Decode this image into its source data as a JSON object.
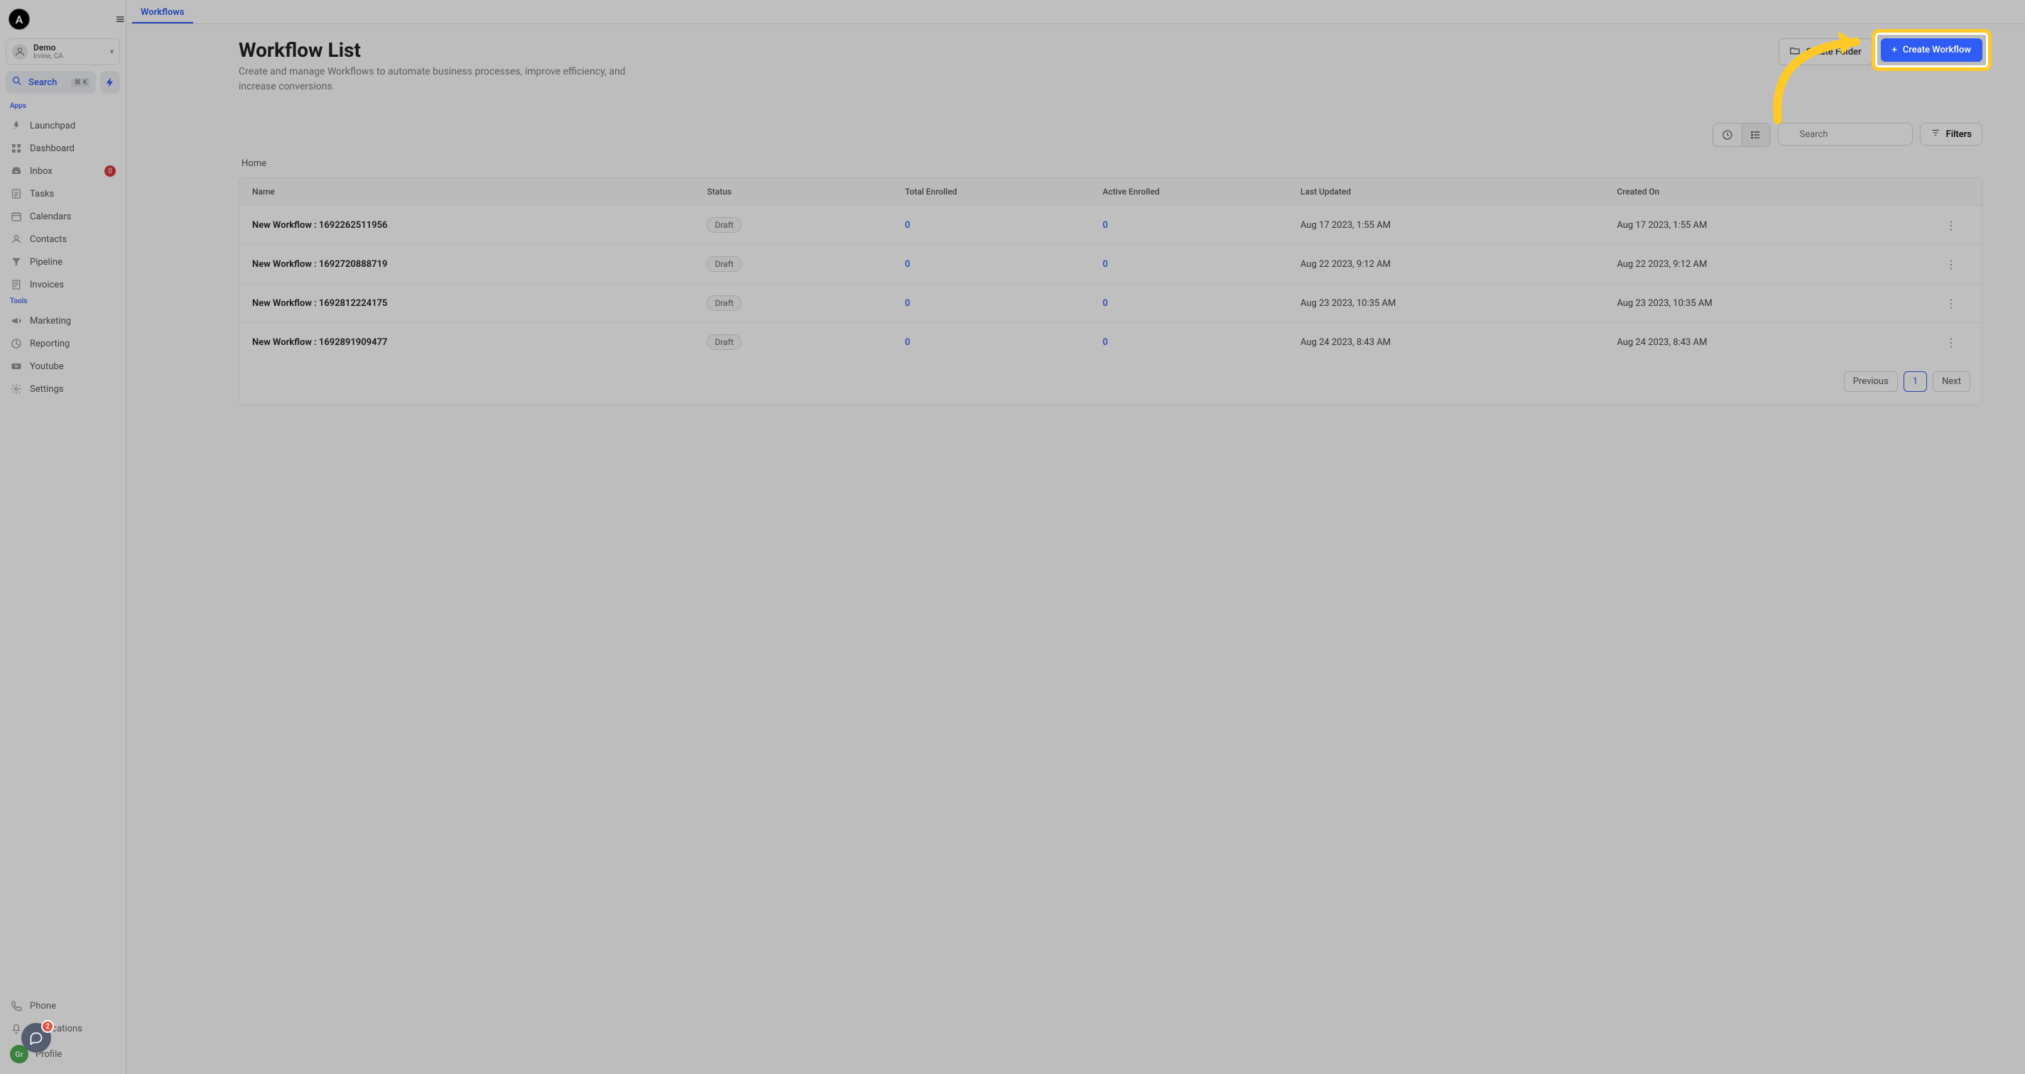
{
  "brand": {
    "logo_letter": "A"
  },
  "account": {
    "name": "Demo",
    "location": "Irvine, CA"
  },
  "searchbox": {
    "label": "Search",
    "shortcut": "⌘ K"
  },
  "sections": {
    "apps_label": "Apps",
    "tools_label": "Tools"
  },
  "nav": {
    "launchpad": "Launchpad",
    "dashboard": "Dashboard",
    "inbox": "Inbox",
    "inbox_count": "0",
    "tasks": "Tasks",
    "calendars": "Calendars",
    "contacts": "Contacts",
    "pipeline": "Pipeline",
    "invoices": "Invoices",
    "marketing": "Marketing",
    "reporting": "Reporting",
    "youtube": "Youtube",
    "settings": "Settings",
    "phone": "Phone",
    "notifications": "Notifications",
    "profile": "Profile",
    "profile_initials": "Gr"
  },
  "chat_badge": "2",
  "tabs": {
    "workflows": "Workflows"
  },
  "page": {
    "title": "Workflow List",
    "subtitle": "Create and manage Workflows to automate business processes, improve efficiency, and increase conversions.",
    "create_folder": "Create Folder",
    "create_workflow": "Create Workflow",
    "search_placeholder": "Search",
    "filters": "Filters",
    "breadcrumb": "Home"
  },
  "columns": {
    "name": "Name",
    "status": "Status",
    "total_enrolled": "Total Enrolled",
    "active_enrolled": "Active Enrolled",
    "last_updated": "Last Updated",
    "created_on": "Created On"
  },
  "rows": [
    {
      "name": "New Workflow : 1692262511956",
      "status": "Draft",
      "total": "0",
      "active": "0",
      "updated": "Aug 17 2023, 1:55 AM",
      "created": "Aug 17 2023, 1:55 AM"
    },
    {
      "name": "New Workflow : 1692720888719",
      "status": "Draft",
      "total": "0",
      "active": "0",
      "updated": "Aug 22 2023, 9:12 AM",
      "created": "Aug 22 2023, 9:12 AM"
    },
    {
      "name": "New Workflow : 1692812224175",
      "status": "Draft",
      "total": "0",
      "active": "0",
      "updated": "Aug 23 2023, 10:35 AM",
      "created": "Aug 23 2023, 10:35 AM"
    },
    {
      "name": "New Workflow : 1692891909477",
      "status": "Draft",
      "total": "0",
      "active": "0",
      "updated": "Aug 24 2023, 8:43 AM",
      "created": "Aug 24 2023, 8:43 AM"
    }
  ],
  "pagination": {
    "prev": "Previous",
    "page": "1",
    "next": "Next"
  }
}
